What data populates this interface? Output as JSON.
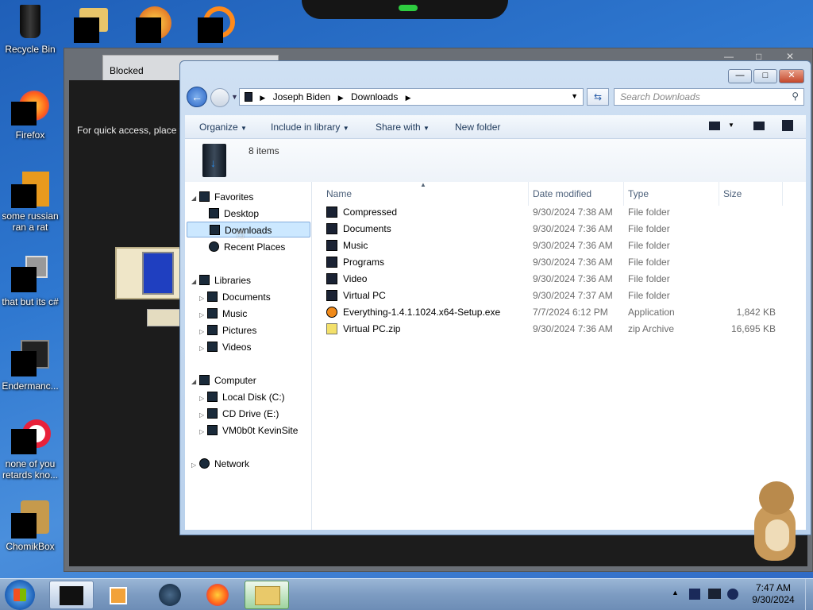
{
  "desktop": {
    "icons": [
      {
        "label": "Recycle Bin"
      },
      {
        "label": "Firefox"
      },
      {
        "label": "some russian ran a rat"
      },
      {
        "label": "that but its c#"
      },
      {
        "label": "Endermanc..."
      },
      {
        "label": "none of you retards kno..."
      },
      {
        "label": "ChomikBox"
      }
    ]
  },
  "browser": {
    "tab_title": "Blocked",
    "quick_access_text": "For quick access, place y"
  },
  "explorer": {
    "address": {
      "segments": [
        "Joseph Biden",
        "Downloads"
      ]
    },
    "search_placeholder": "Search Downloads",
    "toolbar": {
      "organize": "Organize",
      "include_in_library": "Include in library",
      "share_with": "Share with",
      "new_folder": "New folder"
    },
    "item_count": "8 items",
    "nav": {
      "favorites": "Favorites",
      "desktop": "Desktop",
      "downloads": "Downloads",
      "recent_places": "Recent Places",
      "libraries": "Libraries",
      "documents": "Documents",
      "music": "Music",
      "pictures": "Pictures",
      "videos": "Videos",
      "computer": "Computer",
      "local_disk": "Local Disk (C:)",
      "cd_drive": "CD Drive (E:)",
      "share": "VM0b0t KevinSite",
      "network": "Network"
    },
    "columns": {
      "name": "Name",
      "date_modified": "Date modified",
      "type": "Type",
      "size": "Size"
    },
    "files": [
      {
        "name": "Compressed",
        "date": "9/30/2024 7:38 AM",
        "type": "File folder",
        "size": "",
        "icon": "folder-icon"
      },
      {
        "name": "Documents",
        "date": "9/30/2024 7:36 AM",
        "type": "File folder",
        "size": "",
        "icon": "folder-icon"
      },
      {
        "name": "Music",
        "date": "9/30/2024 7:36 AM",
        "type": "File folder",
        "size": "",
        "icon": "folder-icon"
      },
      {
        "name": "Programs",
        "date": "9/30/2024 7:36 AM",
        "type": "File folder",
        "size": "",
        "icon": "folder-icon"
      },
      {
        "name": "Video",
        "date": "9/30/2024 7:36 AM",
        "type": "File folder",
        "size": "",
        "icon": "folder-icon"
      },
      {
        "name": "Virtual PC",
        "date": "9/30/2024 7:37 AM",
        "type": "File folder",
        "size": "",
        "icon": "folder-icon"
      },
      {
        "name": "Everything-1.4.1.1024.x64-Setup.exe",
        "date": "7/7/2024 6:12 PM",
        "type": "Application",
        "size": "1,842 KB",
        "icon": "search-app-icon"
      },
      {
        "name": "Virtual PC.zip",
        "date": "9/30/2024 7:36 AM",
        "type": "zip Archive",
        "size": "16,695 KB",
        "icon": "zip-icon"
      }
    ]
  },
  "taskbar": {
    "time": "7:47 AM",
    "date": "9/30/2024"
  },
  "colors": {
    "selection": "#cce8ff",
    "accent": "#1e395b"
  }
}
